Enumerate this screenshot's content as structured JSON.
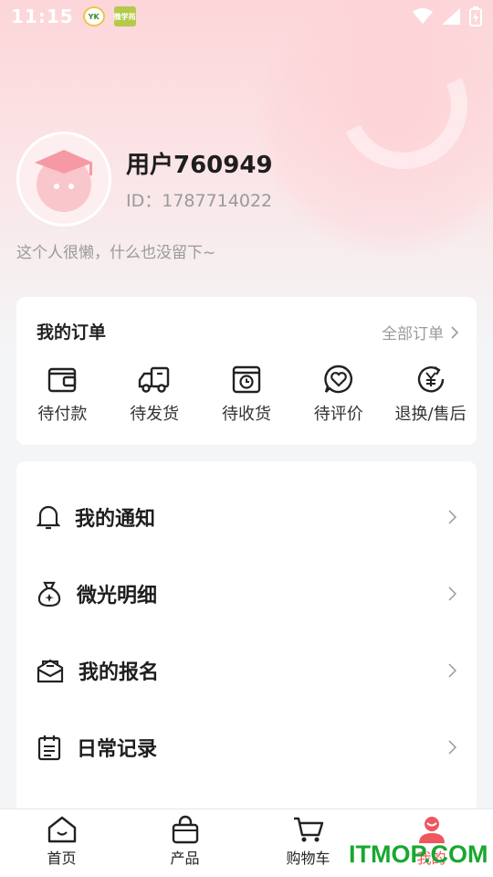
{
  "status_bar": {
    "time": "11:15",
    "app_icons": [
      "yk-app-icon",
      "green-app-icon"
    ],
    "app_icon_texts": [
      "YK",
      "微学苑"
    ]
  },
  "profile": {
    "username": "用户760949",
    "user_id": "ID：1787714022",
    "bio": "这个人很懒，什么也没留下~"
  },
  "orders": {
    "title": "我的订单",
    "all_label": "全部订单",
    "items": [
      {
        "label": "待付款",
        "icon": "wallet-icon"
      },
      {
        "label": "待发货",
        "icon": "delivery-truck-icon"
      },
      {
        "label": "待收货",
        "icon": "box-clock-icon"
      },
      {
        "label": "待评价",
        "icon": "heart-chat-icon"
      },
      {
        "label": "退换/售后",
        "icon": "yen-refresh-icon"
      }
    ]
  },
  "menu": {
    "items": [
      {
        "label": "我的通知",
        "icon": "bell-icon"
      },
      {
        "label": "微光明细",
        "icon": "money-bag-icon"
      },
      {
        "label": "我的报名",
        "icon": "mail-tray-icon"
      },
      {
        "label": "日常记录",
        "icon": "calendar-icon"
      }
    ]
  },
  "tabbar": {
    "items": [
      {
        "label": "首页",
        "icon": "home-icon",
        "active": false
      },
      {
        "label": "产品",
        "icon": "shopping-bag-icon",
        "active": false
      },
      {
        "label": "购物车",
        "icon": "cart-icon",
        "active": false
      },
      {
        "label": "我的",
        "icon": "user-icon",
        "active": true
      }
    ]
  },
  "watermark": "ITMOP.COM",
  "colors": {
    "accent": "#f0565e",
    "hero_pink": "#fcd6d9",
    "watermark_green": "#18a82e"
  }
}
